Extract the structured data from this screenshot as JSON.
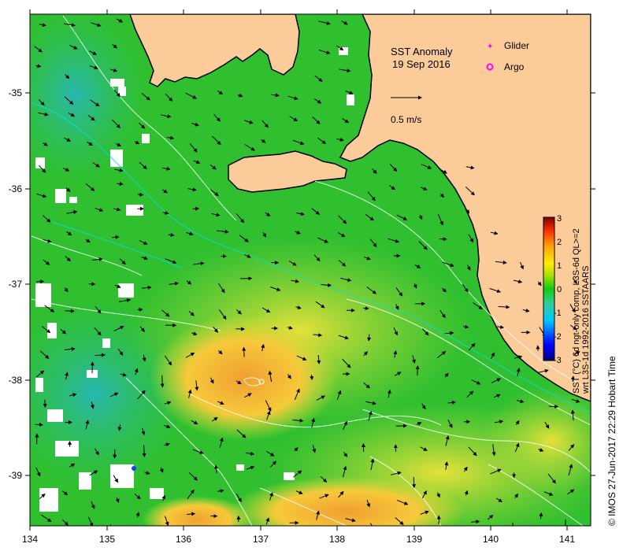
{
  "title": {
    "line1": "SST Anomaly",
    "line2": "19 Sep 2016"
  },
  "legend": {
    "glider_label": "Glider",
    "argo_label": "Argo",
    "glider_color": "#ff00ff",
    "argo_color": "#ff00ff",
    "scale_label": "0.5 m/s"
  },
  "colorbar": {
    "ticks": [
      "3",
      "2",
      "1",
      "0",
      "-1",
      "-2",
      "-3"
    ],
    "range": [
      -3,
      3
    ],
    "caption_line1": "SST (°C) 6d ngt-only comp, L3S-6d QL>=2",
    "caption_line2": "wrt L3S-1d 1992-2016 SSTAARS",
    "colors": [
      "#00007f",
      "#0000ff",
      "#00bfff",
      "#3fc87f",
      "#00cc00",
      "#a0e000",
      "#ffff00",
      "#ffa500",
      "#ff4000",
      "#8b0000"
    ]
  },
  "credit": "©  IMOS 27-Jun-2017 22:29 Hobart Time",
  "axes": {
    "x_ticks": [
      "134",
      "135",
      "136",
      "137",
      "138",
      "139",
      "140",
      "141"
    ],
    "y_ticks": [
      "-35",
      "-36",
      "-37",
      "-38",
      "-39"
    ],
    "x_range": [
      134,
      141.3
    ],
    "y_range": [
      -39.5,
      -34.2
    ]
  },
  "colors": {
    "land": "#fccb9a",
    "coast": "#000000",
    "background_anomaly": "#2fc02f",
    "warm_anomaly": "#f2a63a",
    "cool_anomaly": "#28b4a0",
    "no_data": "#ffffff"
  }
}
